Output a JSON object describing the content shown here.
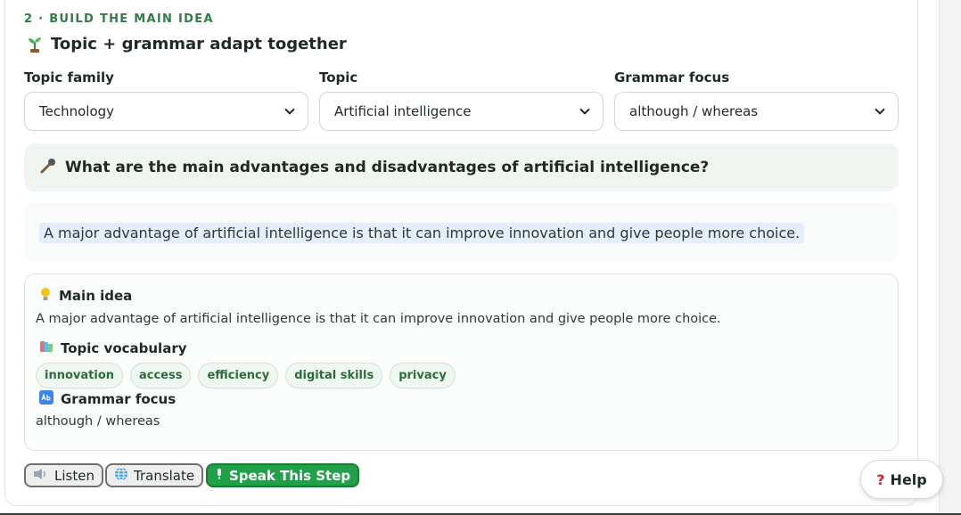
{
  "step": {
    "label": "2 · BUILD THE MAIN IDEA",
    "title": "Topic + grammar adapt together"
  },
  "fields": {
    "topic_family": {
      "label": "Topic family",
      "value": "Technology"
    },
    "topic": {
      "label": "Topic",
      "value": "Artificial intelligence"
    },
    "grammar": {
      "label": "Grammar focus",
      "value": "although / whereas"
    }
  },
  "question": "What are the main advantages and disadvantages of artificial intelligence?",
  "answer": "A major advantage of artificial intelligence is that it can improve innovation and give people more choice.",
  "summary": {
    "main_idea_heading": "Main idea",
    "main_idea_text": "A major advantage of artificial intelligence is that it can improve innovation and give people more choice.",
    "vocab_heading": "Topic vocabulary",
    "vocab": [
      "innovation",
      "access",
      "efficiency",
      "digital skills",
      "privacy"
    ],
    "grammar_heading": "Grammar focus",
    "grammar_text": "although / whereas"
  },
  "buttons": {
    "listen": "Listen",
    "translate": "Translate",
    "speak": "Speak This Step"
  },
  "help": {
    "label": "Help",
    "icon": "?"
  },
  "icons": {
    "sprout": "sprout-icon",
    "mic": "microphone-icon",
    "bulb": "lightbulb-icon",
    "books": "books-icon",
    "abc": "abc-icon",
    "speaker": "speaker-icon",
    "globe": "globe-icon"
  },
  "colors": {
    "accent_green": "#21a04a",
    "label_green": "#2f7d46",
    "help_red": "#d6263a"
  }
}
